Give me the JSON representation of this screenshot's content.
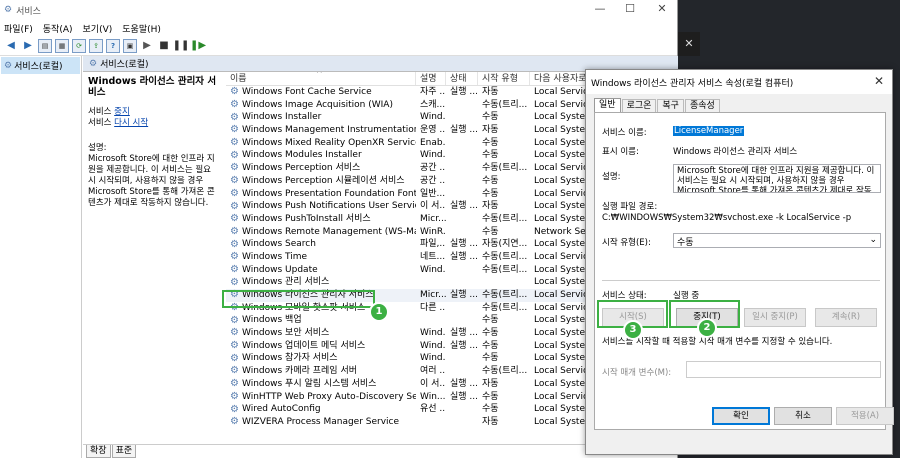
{
  "window": {
    "title": "서비스"
  },
  "menu": [
    "파일(F)",
    "동작(A)",
    "보기(V)",
    "도움말(H)"
  ],
  "tree": {
    "root": "서비스(로컬)"
  },
  "header": {
    "title": "서비스(로컬)"
  },
  "desc": {
    "title": "Windows 라이선스 관리자 서비스",
    "service_prefix": "서비스 ",
    "stop_link": "중지",
    "restart_link": "다시 시작",
    "desc_label": "설명:",
    "desc_text": "Microsoft Store에 대한 인프라 지원을 제공합니다. 이 서비스는 필요 시 시작되며, 사용하지 않을 경우 Microsoft Store를 통해 가져온 콘텐츠가 제대로 작동하지 않습니다."
  },
  "columns": {
    "name": "이름",
    "desc": "설명",
    "status": "상태",
    "start": "시작 유형",
    "logon": "다음 사용자로 로그온"
  },
  "rows": [
    {
      "name": "Windows Font Cache Service",
      "desc": "자주 ...",
      "status": "실행 ...",
      "start": "자동",
      "logon": "Local Service"
    },
    {
      "name": "Windows Image Acquisition (WIA)",
      "desc": "스캐...",
      "status": "",
      "start": "수동(트리...",
      "logon": "Local Service"
    },
    {
      "name": "Windows Installer",
      "desc": "Wind...",
      "status": "",
      "start": "수동",
      "logon": "Local System"
    },
    {
      "name": "Windows Management Instrumentation",
      "desc": "운영 ...",
      "status": "실행 ...",
      "start": "자동",
      "logon": "Local System"
    },
    {
      "name": "Windows Mixed Reality OpenXR Service",
      "desc": "Enab...",
      "status": "",
      "start": "수동",
      "logon": "Local System"
    },
    {
      "name": "Windows Modules Installer",
      "desc": "Wind...",
      "status": "",
      "start": "수동",
      "logon": "Local System"
    },
    {
      "name": "Windows Perception 서비스",
      "desc": "공간 ...",
      "status": "",
      "start": "수동(트리...",
      "logon": "Local Service"
    },
    {
      "name": "Windows Perception 시뮬레이션 서비스",
      "desc": "공간 ...",
      "status": "",
      "start": "수동",
      "logon": "Local System"
    },
    {
      "name": "Windows Presentation Foundation Font Cach...",
      "desc": "일반...",
      "status": "",
      "start": "수동",
      "logon": "Local Service"
    },
    {
      "name": "Windows Push Notifications User Service_427...",
      "desc": "이 서...",
      "status": "실행 ...",
      "start": "자동",
      "logon": "Local System"
    },
    {
      "name": "Windows PushToInstall 서비스",
      "desc": "Micr...",
      "status": "",
      "start": "수동(트리...",
      "logon": "Local System"
    },
    {
      "name": "Windows Remote Management (WS-Manage...",
      "desc": "WinR...",
      "status": "",
      "start": "수동",
      "logon": "Network Serv"
    },
    {
      "name": "Windows Search",
      "desc": "파일,...",
      "status": "실행 ...",
      "start": "자동(지연...",
      "logon": "Local System"
    },
    {
      "name": "Windows Time",
      "desc": "네트...",
      "status": "실행 ...",
      "start": "수동(트리...",
      "logon": "Local Service"
    },
    {
      "name": "Windows Update",
      "desc": "Wind...",
      "status": "",
      "start": "수동(트리...",
      "logon": "Local System"
    },
    {
      "name": "Windows 관리 서비스",
      "desc": "",
      "status": "",
      "start": "",
      "logon": "Local System"
    },
    {
      "name": "Windows 라이선스 관리자 서비스",
      "desc": "Micr...",
      "status": "실행 ...",
      "start": "수동(트리...",
      "logon": "Local Service"
    },
    {
      "name": "Windows 모바일 핫스팟 서비스",
      "desc": "다른 ...",
      "status": "",
      "start": "수동(트리...",
      "logon": "Local Service"
    },
    {
      "name": "Windows 백업",
      "desc": "",
      "status": "",
      "start": "수동",
      "logon": "Local System"
    },
    {
      "name": "Windows 보안 서비스",
      "desc": "Wind...",
      "status": "실행 ...",
      "start": "수동",
      "logon": "Local System"
    },
    {
      "name": "Windows 업데이트 메딕 서비스",
      "desc": "Wind...",
      "status": "실행 ...",
      "start": "수동",
      "logon": "Local System"
    },
    {
      "name": "Windows 참가자 서비스",
      "desc": "Wind...",
      "status": "",
      "start": "수동",
      "logon": "Local System"
    },
    {
      "name": "Windows 카메라 프레임 서버",
      "desc": "여러 ...",
      "status": "",
      "start": "수동(트리...",
      "logon": "Local Service"
    },
    {
      "name": "Windows 푸시 알림 시스템 서비스",
      "desc": "이 서...",
      "status": "실행 ...",
      "start": "자동",
      "logon": "Local System"
    },
    {
      "name": "WinHTTP Web Proxy Auto-Discovery Service",
      "desc": "Win...",
      "status": "실행 ...",
      "start": "수동",
      "logon": "Local Service"
    },
    {
      "name": "Wired AutoConfig",
      "desc": "유선 ...",
      "status": "",
      "start": "수동",
      "logon": "Local System"
    },
    {
      "name": "WIZVERA Process Manager Service",
      "desc": "",
      "status": "",
      "start": "자동",
      "logon": "Local System"
    }
  ],
  "tabs": [
    "확장",
    "표준"
  ],
  "dialog": {
    "title": "Windows 라이선스 관리자 서비스 속성(로컬 컴퓨터)",
    "tabs": [
      "일반",
      "로그온",
      "복구",
      "종속성"
    ],
    "svc_name_label": "서비스 이름:",
    "svc_name": "LicenseManager",
    "display_label": "표시 이름:",
    "display_name": "Windows 라이선스 관리자 서비스",
    "desc_label": "설명:",
    "desc_text": "Microsoft Store에 대한 인프라 지원을 제공합니다. 이 서비스는 필요 시 시작되며, 사용하지 않을 경우 Microsoft Store를 통해 가져온 콘텐츠가 제대로 작동하지 않습니다.",
    "path_label": "실행 파일 경로:",
    "path": "C:₩WINDOWS₩System32₩svchost.exe -k LocalService -p",
    "start_type_label": "시작 유형(E):",
    "start_type": "수동",
    "status_label": "서비스 상태:",
    "status": "실행 중",
    "btn_start": "시작(S)",
    "btn_stop": "중지(T)",
    "btn_pause": "일시 중지(P)",
    "btn_resume": "계속(R)",
    "hint": "서비스를 시작할 때 적용할 시작 매개 변수를 지정할 수 있습니다.",
    "param_label": "시작 매개 변수(M):",
    "btn_ok": "확인",
    "btn_cancel": "취소",
    "btn_apply": "적용(A)"
  },
  "badges": [
    "1",
    "2",
    "3"
  ],
  "dark": {
    "close": "✕"
  }
}
